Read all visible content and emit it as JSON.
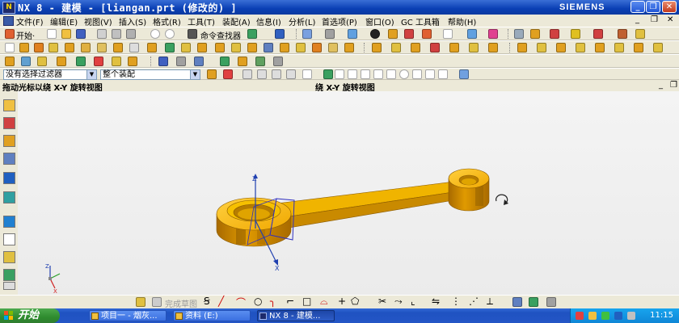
{
  "window": {
    "title": "NX 8 - 建模 - [liangan.prt  (修改的) ]",
    "brand": "SIEMENS",
    "controls": [
      "_",
      "❐",
      "✕"
    ]
  },
  "menu": [
    "文件(F)",
    "编辑(E)",
    "视图(V)",
    "插入(S)",
    "格式(R)",
    "工具(T)",
    "装配(A)",
    "信息(I)",
    "分析(L)",
    "首选项(P)",
    "窗口(O)",
    "GC 工具箱",
    "帮助(H)"
  ],
  "toolbar": {
    "start_label": "开始·",
    "command_finder_label": "命令查找器"
  },
  "selection_bar": {
    "filter_value": "没有选择过滤器",
    "scope_value": "整个装配"
  },
  "cue_line": {
    "left_prompt": "拖动光标以绕 X-Y 旋转视图",
    "status": "绕 X-Y 旋转视图"
  },
  "graphics": {
    "triad_labels": [
      "Z",
      "X"
    ],
    "wcs_labels": [
      "Z",
      "X"
    ]
  },
  "draw_toolbar": {
    "disabled_label": "完成草图"
  },
  "taskbar": {
    "start_label": "开始",
    "tasks": [
      {
        "label": "项目一 - 烟灰..."
      },
      {
        "label": "资料 (E:)"
      },
      {
        "label": "NX 8 - 建模..."
      }
    ],
    "clock": "11:15"
  },
  "colors": {
    "title_bar": "#0a3fb4",
    "part_body": "#f0b400",
    "part_side": "#c98a00",
    "part_dark": "#8a5a00",
    "taskbar": "#2456c6",
    "start_button": "#2e8b2e"
  }
}
